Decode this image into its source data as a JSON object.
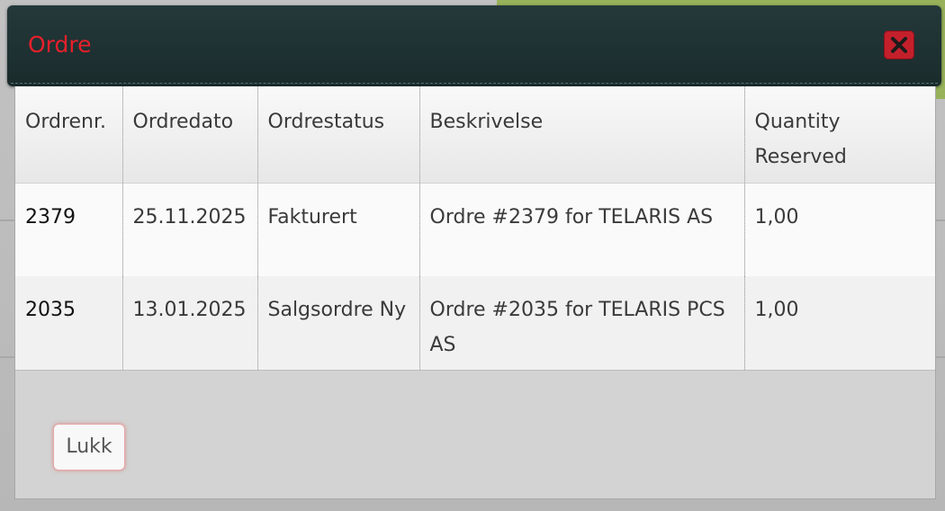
{
  "dialog": {
    "title": "Ordre",
    "close_icon": "close-icon",
    "close_button_label": "Lukk"
  },
  "table": {
    "columns": [
      "Ordrenr.",
      "Ordredato",
      "Ordrestatus",
      "Beskrivelse",
      "Quantity Reserved"
    ],
    "rows": [
      {
        "order_no": "2379",
        "order_date": "25.11.2025",
        "status": "Fakturert",
        "description": "Ordre #2379 for TELARIS AS",
        "quantity_reserved": "1,00"
      },
      {
        "order_no": "2035",
        "order_date": "13.01.2025",
        "status": "Salgsordre Ny",
        "description": "Ordre #2035 for TELARIS PCS AS",
        "quantity_reserved": "1,00"
      }
    ]
  },
  "colors": {
    "titlebar": "#1f3233",
    "title_text": "#e8202b",
    "close_button": "#c4202c",
    "background_accent": "#97b25b"
  }
}
